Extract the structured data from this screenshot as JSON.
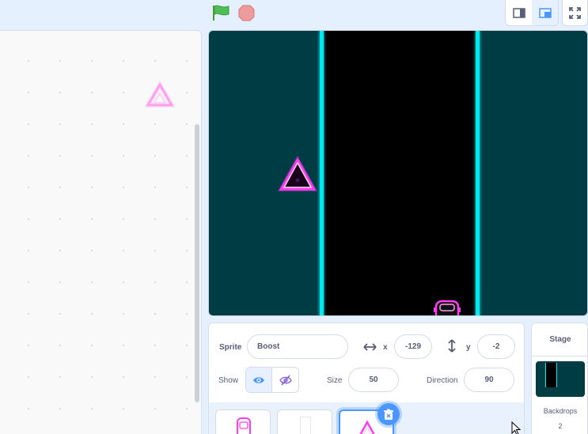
{
  "sprite_info": {
    "sprite_label": "Sprite",
    "sprite_name": "Boost",
    "x_label": "x",
    "x_value": "-129",
    "y_label": "y",
    "y_value": "-2",
    "show_label": "Show",
    "size_label": "Size",
    "size_value": "50",
    "direction_label": "Direction",
    "direction_value": "90"
  },
  "stage_panel": {
    "title": "Stage",
    "backdrops_label": "Backdrops",
    "backdrops_count": "2"
  },
  "colors": {
    "stage_bg": "#003c44",
    "lane": "#00e8f0",
    "accent": "#4c97ff",
    "boost": "#ff3cf0"
  },
  "icons": {
    "green_flag": "green-flag-icon",
    "stop": "stop-icon",
    "small_stage": "small-stage-icon",
    "normal_stage": "normal-stage-icon",
    "fullscreen": "fullscreen-icon",
    "show_visible": "eye-icon",
    "show_hidden": "eye-slash-icon",
    "delete": "trash-icon"
  }
}
